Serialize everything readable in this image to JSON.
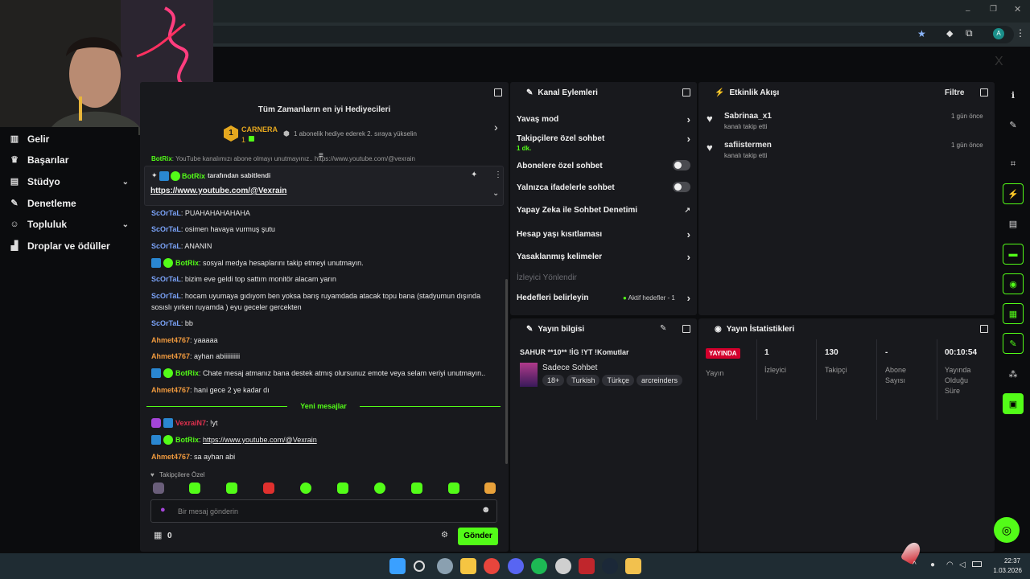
{
  "sidebar": {
    "items": [
      {
        "label": "Gelir",
        "icon": "chart-icon"
      },
      {
        "label": "Başarılar",
        "icon": "trophy-icon"
      },
      {
        "label": "Stüdyo",
        "icon": "studio-icon"
      },
      {
        "label": "Denetleme",
        "icon": "wrench-icon"
      },
      {
        "label": "Topluluk",
        "icon": "community-icon"
      },
      {
        "label": "Droplar ve ödüller",
        "icon": "drops-icon"
      }
    ]
  },
  "gifters": {
    "title": "Tüm Zamanların en iyi Hediyecileri",
    "rank": "1",
    "name": "CARNERA",
    "count": "1",
    "hint": "1 abonelik hediye ederek 2. sıraya yükselin"
  },
  "pinned": {
    "pinned_by": "BotRix",
    "pinned_text": "tarafından sabitlendi",
    "link": "https://www.youtube.com/@Vexrain",
    "partial_above": "YouTube kanalımızı abone olmayı unutmayınız.. https://www.youtube.com/@vexrain"
  },
  "chat": {
    "messages": [
      {
        "user": "ScOrTaL",
        "text": "PUAHAHAHAHAHA"
      },
      {
        "user": "ScOrTaL",
        "text": "osimen havaya vurmuş şutu"
      },
      {
        "user": "ScOrTaL",
        "text": "ANANIN"
      },
      {
        "user": "BotRix",
        "text": "sosyal medya hesaplarını takip etmeyi unutmayın."
      },
      {
        "user": "ScOrTaL",
        "text": "bizim eve geldi top sattım monitör alacam yarın"
      },
      {
        "user": "ScOrTaL",
        "text": "hocam uyumaya gıdıyom ben yoksa barış ruyamdada atacak topu bana (stadyumun dışında sosıslı yırken ruyamda ) eyu geceler gercekten"
      },
      {
        "user": "ScOrTaL",
        "text": "bb"
      },
      {
        "user": "Ahmet4767",
        "text": "yaaaaa"
      },
      {
        "user": "Ahmet4767",
        "text": "ayhan abiiiiiiiiii"
      },
      {
        "user": "BotRix",
        "text": "Chate mesaj atmanız bana destek atmış olursunuz emote veya selam veriyi unutmayın.."
      },
      {
        "user": "Ahmet4767",
        "text": "hani gece 2 ye kadar dı"
      }
    ],
    "new_messages_label": "Yeni mesajlar",
    "new": [
      {
        "user": "VexraiN7",
        "text": "!yt"
      },
      {
        "user": "BotRix",
        "text": "https://www.youtube.com/@Vexrain"
      },
      {
        "user": "Ahmet4767",
        "text": "sa ayhan abi"
      }
    ],
    "followers_only": "Takipçilere Özel",
    "input_placeholder": "Bir mesaj gönderin",
    "points": "0",
    "send_label": "Gönder"
  },
  "mod": {
    "title": "Kanal Eylemleri",
    "slow_mode": "Yavaş mod",
    "followers_chat": "Takipçilere özel sohbet",
    "followers_chat_sub": "1 dk.",
    "subs_chat": "Abonelere özel sohbet",
    "emote_chat": "Yalnızca ifadelerle sohbet",
    "ai_mod": "Yapay Zeka ile Sohbet Denetimi",
    "account_age": "Hesap yaşı kısıtlaması",
    "banned_words": "Yasaklanmış kelimeler",
    "redirect": "İzleyici Yönlendir",
    "goals": "Hedefleri belirleyin",
    "goals_status": "Aktif hedefler - 1"
  },
  "activity": {
    "title": "Etkinlik Akışı",
    "filter": "Filtre",
    "events": [
      {
        "user": "Sabrinaa_x1",
        "action": "kanalı takip etti",
        "time": "1 gün önce"
      },
      {
        "user": "safiistermen",
        "action": "kanalı takip etti",
        "time": "1 gün önce"
      }
    ]
  },
  "stream_info": {
    "title": "Yayın bilgisi",
    "stream_title": "SAHUR **10** !İG !YT !Komutlar",
    "category": "Sadece Sohbet",
    "tags": [
      "18+",
      "Turkish",
      "Türkçe",
      "arcreinders"
    ]
  },
  "stats": {
    "title": "Yayın İstatistikleri",
    "live_badge": "YAYINDA",
    "live_label": "Yayın",
    "viewers": "1",
    "viewers_label": "İzleyici",
    "followers": "130",
    "followers_label": "Takipçi",
    "subs": "-",
    "subs_label": "Abone Sayısı",
    "uptime": "00:10:54",
    "uptime_label": "Yayında Olduğu Süre"
  },
  "taskbar": {
    "time": "22:37",
    "date": "1.03.2026"
  },
  "browser": {
    "avatar_letter": "A"
  },
  "colors": {
    "accent": "#53fc18",
    "panel": "#18191d",
    "live": "#d3002c"
  }
}
